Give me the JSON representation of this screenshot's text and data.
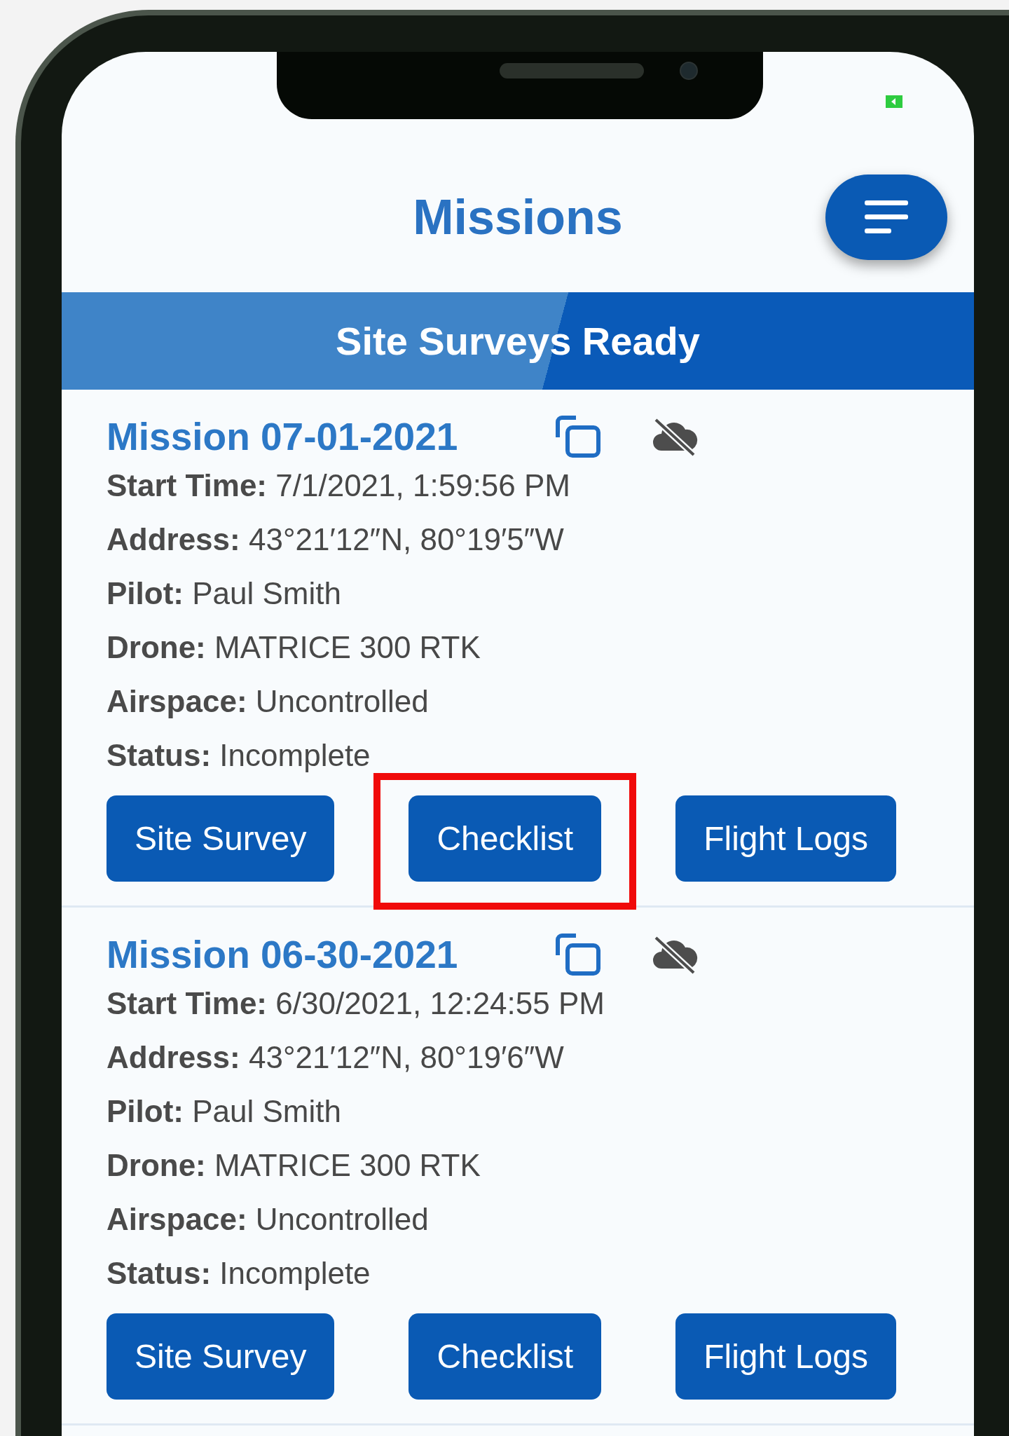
{
  "header": {
    "title": "Missions"
  },
  "banner": {
    "title": "Site Surveys Ready"
  },
  "missions": [
    {
      "title": "Mission 07-01-2021",
      "fields": [
        {
          "label": "Start Time:",
          "value": "7/1/2021, 1:59:56 PM"
        },
        {
          "label": "Address:",
          "value": "43°21′12″N, 80°19′5″W"
        },
        {
          "label": "Pilot:",
          "value": "Paul Smith"
        },
        {
          "label": "Drone:",
          "value": "MATRICE 300 RTK"
        },
        {
          "label": "Airspace:",
          "value": "Uncontrolled"
        },
        {
          "label": "Status:",
          "value": "Incomplete"
        }
      ],
      "buttons": [
        {
          "label": "Site Survey",
          "highlighted": false
        },
        {
          "label": "Checklist",
          "highlighted": true
        },
        {
          "label": "Flight Logs",
          "highlighted": false
        }
      ]
    },
    {
      "title": "Mission 06-30-2021",
      "fields": [
        {
          "label": "Start Time:",
          "value": "6/30/2021, 12:24:55 PM"
        },
        {
          "label": "Address:",
          "value": "43°21′12″N, 80°19′6″W"
        },
        {
          "label": "Pilot:",
          "value": "Paul Smith"
        },
        {
          "label": "Drone:",
          "value": "MATRICE 300 RTK"
        },
        {
          "label": "Airspace:",
          "value": "Uncontrolled"
        },
        {
          "label": "Status:",
          "value": "Incomplete"
        }
      ],
      "buttons": [
        {
          "label": "Site Survey",
          "highlighted": false
        },
        {
          "label": "Checklist",
          "highlighted": false
        },
        {
          "label": "Flight Logs",
          "highlighted": false
        }
      ]
    }
  ]
}
